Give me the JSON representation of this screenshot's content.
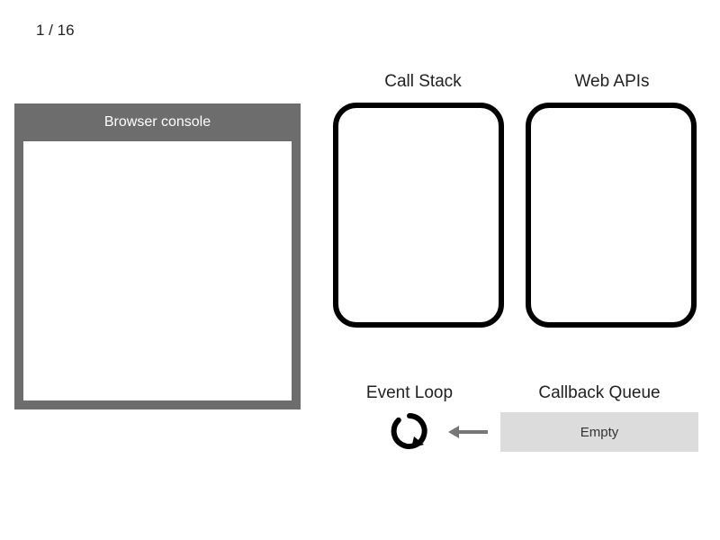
{
  "step": {
    "current": 1,
    "total": 16,
    "display": "1 / 16"
  },
  "console": {
    "title": "Browser console"
  },
  "titles": {
    "call_stack": "Call Stack",
    "web_apis": "Web APIs",
    "event_loop": "Event Loop",
    "callback_queue": "Callback Queue"
  },
  "callback_queue": {
    "status": "Empty"
  }
}
